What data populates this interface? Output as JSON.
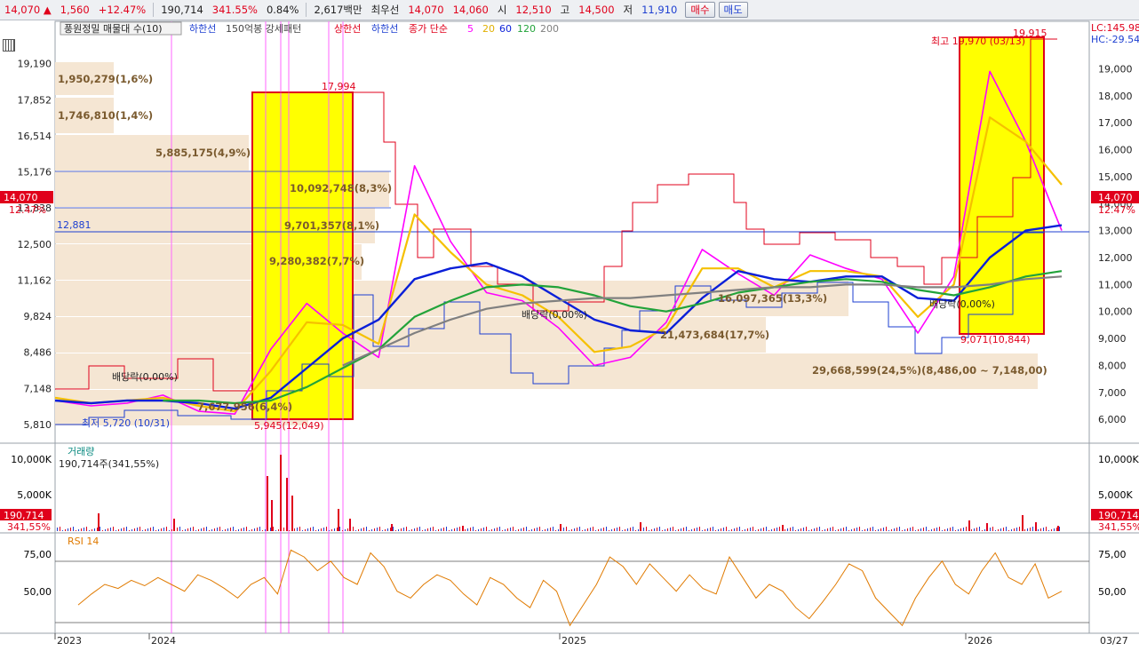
{
  "topbar": {
    "price": "14,070",
    "arrow": "▲",
    "change": "1,560",
    "change_pct": "+12.47%",
    "volume": "190,714",
    "volume_ratio": "341.55%",
    "turnover": "0.84%",
    "amount": "2,617백만",
    "ask_label": "최우선",
    "ask": "14,070",
    "bid": "14,060",
    "open_label": "시",
    "open": "12,510",
    "high_label": "고",
    "high": "14,500",
    "low_label": "저",
    "low": "11,910",
    "buy_label": "매수",
    "sell_label": "매도"
  },
  "legend": {
    "name": "풍원정밀 매물대 수(10)",
    "lower": "하한선",
    "strong": "150억봉 강세패턴",
    "upper": "상한선",
    "lower2": "하한선",
    "ma_label": "종가 단순",
    "ma5": "5",
    "ma20": "20",
    "ma60": "60",
    "ma120": "120",
    "ma200": "200"
  },
  "colors": {
    "up": "#e0001b",
    "down": "#1d3fd1",
    "ma5": "#ff00ff",
    "ma20": "#f5c000",
    "ma60": "#0a1fd8",
    "ma120": "#22a33a",
    "ma200": "#808080",
    "highlight": "#ffff00",
    "profile": "#f5e6d3"
  },
  "chart_data": [
    {
      "type": "line",
      "title": "",
      "x": [
        "2023",
        "2024",
        "2025",
        "2026",
        "03/27"
      ],
      "y_ticks": [
        "19,190",
        "17,852",
        "16,514",
        "15,176",
        "13,838",
        "12,500",
        "11,162",
        "9,824",
        "8,486",
        "7,148",
        "5,810"
      ],
      "y_ticks_right": [
        "19,000",
        "18,000",
        "17,000",
        "16,000",
        "15,000",
        "14,000",
        "13,000",
        "12,000",
        "11,000",
        "10,000",
        "9,000",
        "8,000",
        "7,000",
        "6,000"
      ],
      "ylim": [
        5810,
        20100
      ],
      "current_price": "14,070",
      "current_pct": "12.47%",
      "reference_line": "12,881",
      "lc": "LC:145.98",
      "hc": "HC:-29.54",
      "series": [
        {
          "name": "5",
          "color": "#ff00ff",
          "values": [
            6700,
            6500,
            6600,
            6900,
            6300,
            6200,
            8600,
            10300,
            9200,
            8300,
            15400,
            12600,
            10700,
            10400,
            9400,
            8000,
            8300,
            9600,
            12300,
            11400,
            10600,
            12100,
            11600,
            11200,
            9200,
            11300,
            18900,
            16300,
            13000
          ]
        },
        {
          "name": "20",
          "color": "#f5c000",
          "values": [
            6800,
            6600,
            6700,
            6800,
            6500,
            6300,
            7800,
            9600,
            9500,
            8800,
            13600,
            12200,
            11000,
            10600,
            9800,
            8500,
            8700,
            9400,
            11600,
            11600,
            10900,
            11500,
            11500,
            11300,
            9800,
            11000,
            17200,
            16300,
            14700
          ]
        },
        {
          "name": "60",
          "color": "#0a1fd8",
          "values": [
            6700,
            6600,
            6700,
            6700,
            6600,
            6400,
            6800,
            7900,
            9000,
            9700,
            11200,
            11600,
            11800,
            11300,
            10500,
            9700,
            9300,
            9200,
            10500,
            11500,
            11200,
            11100,
            11300,
            11300,
            10500,
            10400,
            12000,
            13000,
            13200
          ]
        },
        {
          "name": "120",
          "color": "#22a33a",
          "values": [
            null,
            null,
            null,
            6700,
            6700,
            6600,
            6700,
            7200,
            7900,
            8600,
            9800,
            10400,
            10900,
            11000,
            10900,
            10600,
            10200,
            10000,
            10300,
            10700,
            10900,
            11100,
            11200,
            11100,
            10800,
            10600,
            10900,
            11300,
            11500
          ]
        },
        {
          "name": "200",
          "color": "#808080",
          "values": [
            null,
            null,
            null,
            null,
            null,
            null,
            null,
            null,
            8000,
            8600,
            9200,
            9700,
            10100,
            10300,
            10400,
            10500,
            10500,
            10600,
            10700,
            10800,
            10900,
            10900,
            11000,
            11000,
            10900,
            10900,
            11000,
            11200,
            11300
          ]
        }
      ]
    },
    {
      "type": "bar",
      "title": "거래량",
      "label": "190,714주(341,55%)",
      "y_ticks": [
        "10,000K",
        "5,000K"
      ],
      "current": "190,714",
      "current_pct": "341,55%"
    },
    {
      "type": "line",
      "title": "RSI 14",
      "y_ticks": [
        "75,00",
        "50,00"
      ],
      "ylim": [
        20,
        90
      ],
      "values": [
        40,
        48,
        55,
        52,
        58,
        54,
        60,
        55,
        50,
        62,
        58,
        52,
        45,
        55,
        60,
        48,
        80,
        75,
        65,
        72,
        60,
        55,
        78,
        68,
        50,
        45,
        55,
        62,
        58,
        48,
        40,
        60,
        55,
        45,
        38,
        58,
        50,
        25,
        40,
        55,
        75,
        68,
        55,
        70,
        60,
        50,
        62,
        52,
        48,
        75,
        60,
        45,
        55,
        50,
        38,
        30,
        42,
        55,
        70,
        65,
        45,
        35,
        25,
        45,
        60,
        72,
        55,
        48,
        65,
        78,
        60,
        55,
        70,
        45,
        50
      ]
    }
  ],
  "annotations": {
    "peak1": "17,994",
    "low1": "5,945(12,049)",
    "low0": "최저 5,720 (10/31)",
    "div1": "배당락(0,00%)",
    "div2": "배당락(0,00%)",
    "div3": "배당락(0,00%)",
    "peak2": "19,915",
    "high2": "최고 19,970 (03/13)",
    "low2": "9,071(10,844)",
    "p1": "1,950,279(1,6%)",
    "p2": "1,746,810(1,4%)",
    "p3": "5,885,175(4,9%)",
    "p4": "10,092,748(8,3%)",
    "p5": "9,701,357(8,1%)",
    "p6": "9,280,382(7,7%)",
    "p7": "16,097,365(13,3%)",
    "p8": "21,473,684(17,7%)",
    "p9": "29,668,599(24,5%)(8,486,00 ~ 7,148,00)",
    "p10": "7,677,956(6,4%)"
  }
}
